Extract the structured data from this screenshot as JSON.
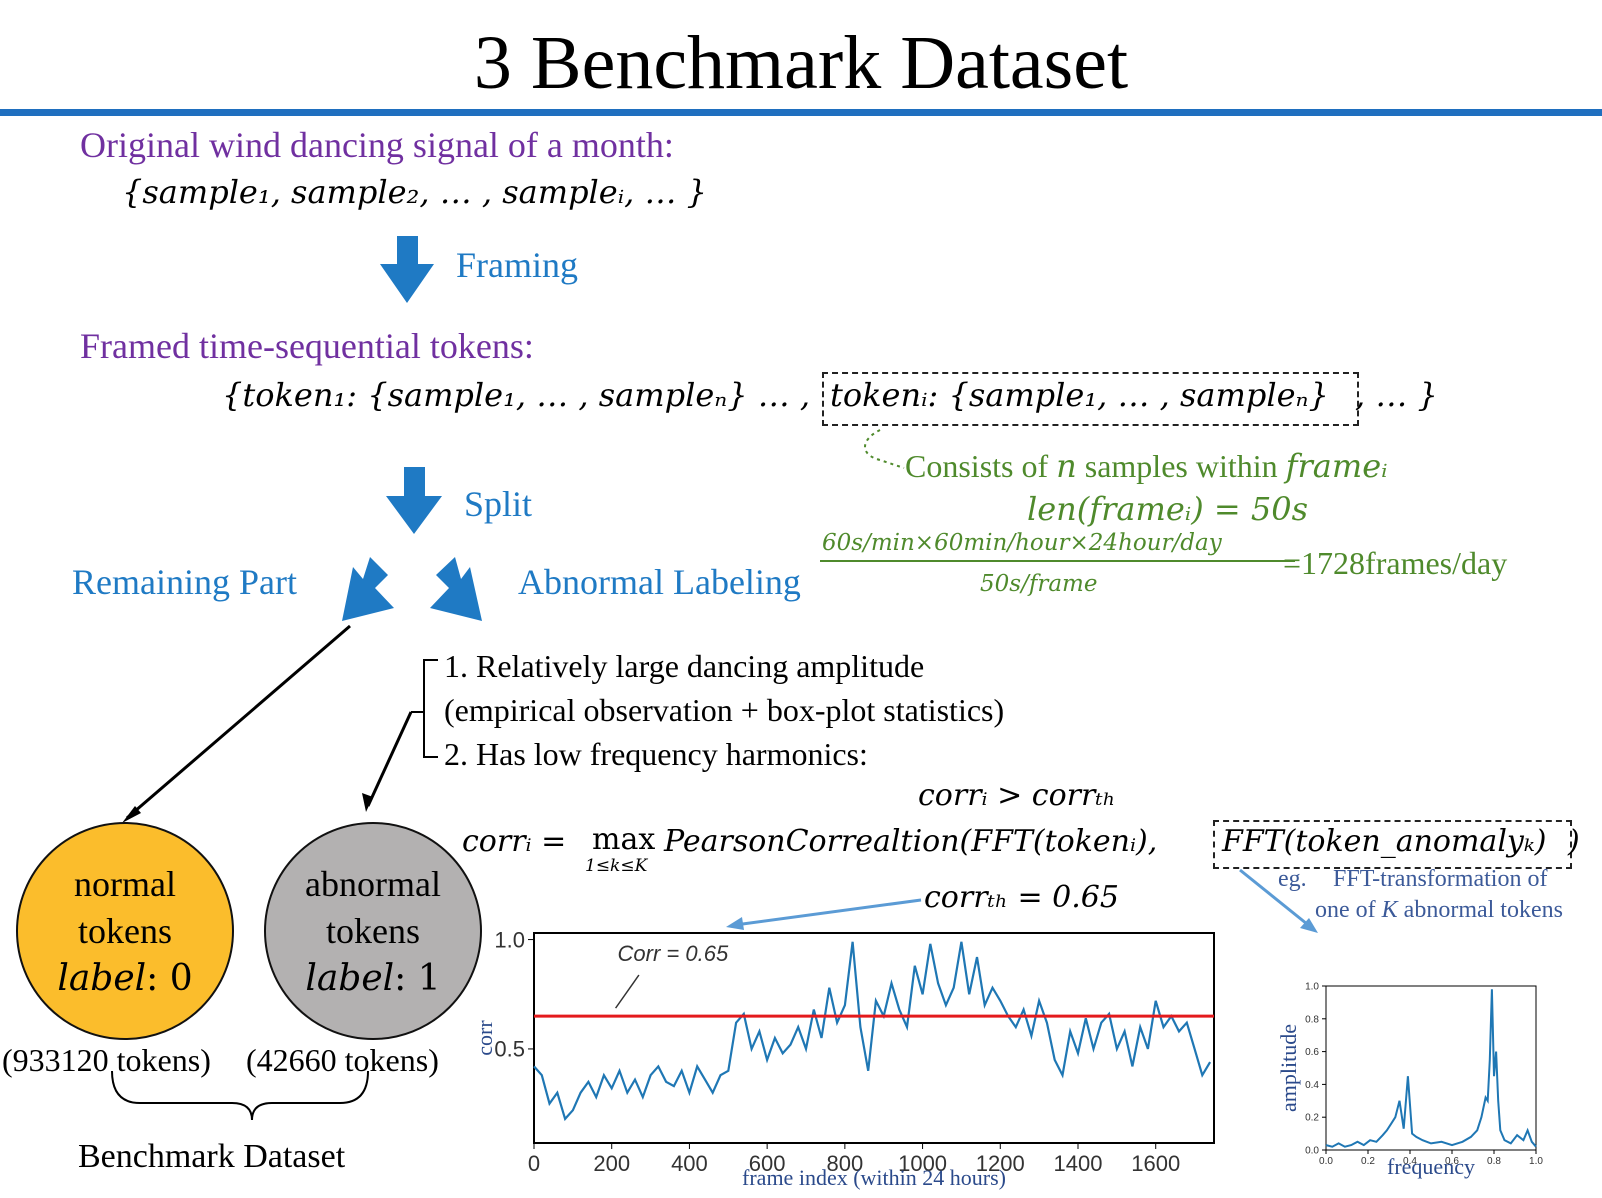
{
  "title": "3  Benchmark Dataset",
  "colors": {
    "accent_blue": "#1f7ac4",
    "purple": "#7030a0",
    "green": "#4f8a2c",
    "normal_fill": "#fbbd2c",
    "abnormal_fill": "#b3b1b1",
    "threshold_red": "#e41a1c",
    "plot_line": "#1f77b4"
  },
  "original_signal": {
    "heading": "Original wind dancing signal of a month:",
    "set_formula": "{sample₁, sample₂, … , sampleᵢ, … }"
  },
  "framing_label": "Framing",
  "framed_tokens": {
    "heading": "Framed time-sequential tokens:",
    "set_left": "{token₁: {sample₁, … , sampleₙ} … ,",
    "set_boxed": "tokenᵢ: {sample₁, … , sampleₙ}",
    "set_right": ", … }"
  },
  "frame_note": {
    "line1_text": "Consists of ",
    "line1_n": "n",
    "line1_mid": " samples within ",
    "line1_frame": "frameᵢ",
    "line2": "len(frameᵢ) = 50s",
    "fraction_numerator": "60s/min×60min/hour×24hour/day",
    "fraction_denominator": "50s/frame",
    "fraction_result": "=1728frames/day"
  },
  "split_label": "Split",
  "remaining_label": "Remaining Part",
  "abnormal_labeling_label": "Abnormal Labeling",
  "criteria": {
    "item1": "1. Relatively large dancing amplitude",
    "item1_note": "(empirical observation + box-plot statistics)",
    "item2": "2. Has low frequency harmonics:",
    "corr_condition": "corrᵢ > corrₜₕ",
    "corr_formula_left": "corrᵢ = ",
    "corr_formula_max": "max",
    "corr_formula_range": "1≤k≤K",
    "corr_formula_mid": " PearsonCorrealtion(FFT(tokenᵢ),",
    "corr_formula_boxed": "FFT(token_anomalyₖ)",
    "corr_formula_end": ")",
    "threshold": "corrₜₕ = 0.65"
  },
  "normal_node": {
    "line1": "normal",
    "line2": "tokens",
    "label_name": "label",
    "label_value": ": 0",
    "count": "(933120 tokens)"
  },
  "abnormal_node": {
    "line1": "abnormal",
    "line2": "tokens",
    "label_name": "label",
    "label_value": ": 1",
    "count": "(42660 tokens)"
  },
  "benchmark_label": "Benchmark Dataset",
  "fft_caption": {
    "prefix": "eg.",
    "line1": "FFT-transformation of",
    "line2_a": "one of ",
    "line2_k": "K",
    "line2_b": " abnormal tokens"
  },
  "chart_data": [
    {
      "type": "line",
      "title": "",
      "xlabel": "frame index (within 24 hours)",
      "ylabel": "corr",
      "xlim": [
        0,
        1750
      ],
      "ylim": [
        0.07,
        1.03
      ],
      "x_ticks": [
        0,
        200,
        400,
        600,
        800,
        1000,
        1200,
        1400,
        1600
      ],
      "x_tick_labels": [
        "0",
        "200",
        "400",
        "600",
        "800",
        "1000",
        "1200",
        "1400",
        "1600"
      ],
      "y_ticks": [
        0.5,
        1.0
      ],
      "y_tick_labels": [
        "0.5",
        "1.0"
      ],
      "threshold": 0.65,
      "annotation": "Corr = 0.65",
      "grid": false,
      "series": [
        {
          "x": [
            0,
            20,
            40,
            60,
            80,
            100,
            120,
            140,
            160,
            180,
            200,
            220,
            240,
            260,
            280,
            300,
            320,
            340,
            360,
            380,
            400,
            420,
            440,
            460,
            480,
            500,
            520,
            540,
            560,
            580,
            600,
            620,
            640,
            660,
            680,
            700,
            720,
            740,
            760,
            780,
            800,
            820,
            840,
            860,
            880,
            900,
            920,
            940,
            960,
            980,
            1000,
            1020,
            1040,
            1060,
            1080,
            1100,
            1120,
            1140,
            1160,
            1180,
            1200,
            1220,
            1240,
            1260,
            1280,
            1300,
            1320,
            1340,
            1360,
            1380,
            1400,
            1420,
            1440,
            1460,
            1480,
            1500,
            1520,
            1540,
            1560,
            1580,
            1600,
            1620,
            1640,
            1660,
            1680,
            1700,
            1720,
            1740
          ],
          "values": [
            0.42,
            0.38,
            0.25,
            0.3,
            0.18,
            0.22,
            0.3,
            0.35,
            0.28,
            0.38,
            0.32,
            0.4,
            0.3,
            0.36,
            0.28,
            0.38,
            0.42,
            0.35,
            0.33,
            0.4,
            0.3,
            0.42,
            0.36,
            0.3,
            0.38,
            0.4,
            0.62,
            0.66,
            0.5,
            0.58,
            0.45,
            0.55,
            0.48,
            0.52,
            0.6,
            0.5,
            0.68,
            0.55,
            0.78,
            0.62,
            0.7,
            0.99,
            0.6,
            0.4,
            0.72,
            0.65,
            0.8,
            0.68,
            0.6,
            0.88,
            0.75,
            0.98,
            0.8,
            0.7,
            0.78,
            0.99,
            0.75,
            0.92,
            0.7,
            0.78,
            0.72,
            0.65,
            0.6,
            0.68,
            0.56,
            0.72,
            0.62,
            0.45,
            0.38,
            0.58,
            0.48,
            0.64,
            0.5,
            0.62,
            0.66,
            0.5,
            0.58,
            0.42,
            0.6,
            0.5,
            0.72,
            0.6,
            0.65,
            0.58,
            0.62,
            0.5,
            0.38,
            0.44
          ]
        }
      ]
    },
    {
      "type": "line",
      "title": "",
      "xlabel": "frequency",
      "ylabel": "amplitude",
      "xlim": [
        0,
        1.0
      ],
      "ylim": [
        0,
        1.0
      ],
      "x_ticks": [
        0,
        0.2,
        0.4,
        0.6,
        0.8,
        1.0
      ],
      "x_tick_labels": [
        "0.0",
        "0.2",
        "0.4",
        "0.6",
        "0.8",
        "1.0"
      ],
      "y_ticks": [
        0,
        0.2,
        0.4,
        0.6,
        0.8,
        1.0
      ],
      "y_tick_labels": [
        "0.0",
        "0.2",
        "0.4",
        "0.6",
        "0.8",
        "1.0"
      ],
      "grid": false,
      "series": [
        {
          "x": [
            0,
            0.03,
            0.06,
            0.09,
            0.12,
            0.15,
            0.18,
            0.21,
            0.24,
            0.27,
            0.29,
            0.31,
            0.33,
            0.35,
            0.37,
            0.39,
            0.41,
            0.43,
            0.46,
            0.5,
            0.55,
            0.6,
            0.65,
            0.69,
            0.72,
            0.74,
            0.76,
            0.77,
            0.78,
            0.79,
            0.8,
            0.81,
            0.82,
            0.83,
            0.85,
            0.88,
            0.91,
            0.94,
            0.96,
            0.98,
            1.0
          ],
          "values": [
            0.03,
            0.02,
            0.04,
            0.02,
            0.03,
            0.05,
            0.03,
            0.06,
            0.05,
            0.09,
            0.12,
            0.16,
            0.2,
            0.3,
            0.13,
            0.45,
            0.1,
            0.08,
            0.06,
            0.04,
            0.05,
            0.03,
            0.05,
            0.08,
            0.12,
            0.2,
            0.32,
            0.3,
            0.55,
            0.98,
            0.45,
            0.6,
            0.3,
            0.12,
            0.06,
            0.04,
            0.09,
            0.06,
            0.12,
            0.05,
            0.02
          ]
        }
      ]
    }
  ]
}
